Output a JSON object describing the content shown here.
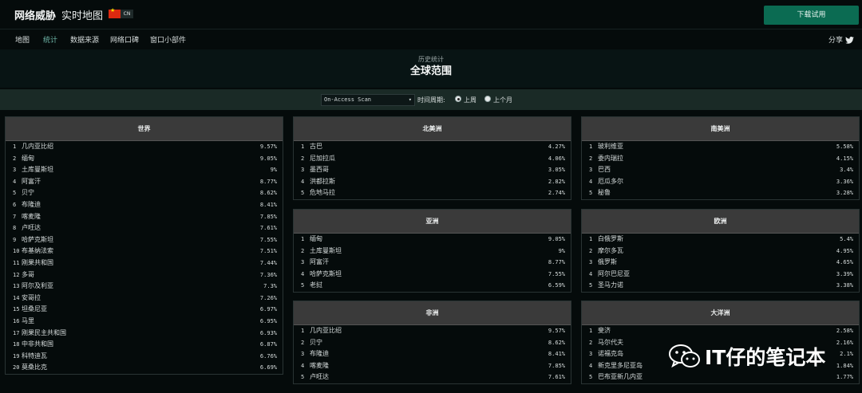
{
  "header": {
    "brand": "网络威胁",
    "subtitle": "实时地图",
    "country_code": "CN",
    "trial_button": "下载试用"
  },
  "nav": {
    "items": [
      "地图",
      "统计",
      "数据来源",
      "网络口碑",
      "窗口小部件"
    ],
    "active": "统计",
    "share": "分享"
  },
  "stats": {
    "subtitle": "历史统计",
    "title": "全球范围"
  },
  "filter": {
    "scan_type": "On-Access Scan",
    "period_label": "时间周期:",
    "options": [
      "上周",
      "上个月"
    ],
    "selected": "上周"
  },
  "panels": {
    "world": {
      "title": "世界",
      "rows": [
        {
          "rank": "1",
          "name": "几内亚比绍",
          "pct": "9.57%"
        },
        {
          "rank": "2",
          "name": "缅甸",
          "pct": "9.05%"
        },
        {
          "rank": "3",
          "name": "土库曼斯坦",
          "pct": "9%"
        },
        {
          "rank": "4",
          "name": "阿富汗",
          "pct": "8.77%"
        },
        {
          "rank": "5",
          "name": "贝宁",
          "pct": "8.62%"
        },
        {
          "rank": "6",
          "name": "布隆迪",
          "pct": "8.41%"
        },
        {
          "rank": "7",
          "name": "喀麦隆",
          "pct": "7.85%"
        },
        {
          "rank": "8",
          "name": "卢旺达",
          "pct": "7.61%"
        },
        {
          "rank": "9",
          "name": "哈萨克斯坦",
          "pct": "7.55%"
        },
        {
          "rank": "10",
          "name": "布基纳法索",
          "pct": "7.51%"
        },
        {
          "rank": "11",
          "name": "刚果共和国",
          "pct": "7.44%"
        },
        {
          "rank": "12",
          "name": "多哥",
          "pct": "7.36%"
        },
        {
          "rank": "13",
          "name": "阿尔及利亚",
          "pct": "7.3%"
        },
        {
          "rank": "14",
          "name": "安哥拉",
          "pct": "7.26%"
        },
        {
          "rank": "15",
          "name": "坦桑尼亚",
          "pct": "6.97%"
        },
        {
          "rank": "16",
          "name": "马里",
          "pct": "6.95%"
        },
        {
          "rank": "17",
          "name": "刚果民主共和国",
          "pct": "6.93%"
        },
        {
          "rank": "18",
          "name": "中非共和国",
          "pct": "6.87%"
        },
        {
          "rank": "19",
          "name": "科特迪瓦",
          "pct": "6.76%"
        },
        {
          "rank": "20",
          "name": "莫桑比克",
          "pct": "6.69%"
        }
      ]
    },
    "north_america": {
      "title": "北美洲",
      "rows": [
        {
          "rank": "1",
          "name": "古巴",
          "pct": "4.27%"
        },
        {
          "rank": "2",
          "name": "尼加拉瓜",
          "pct": "4.06%"
        },
        {
          "rank": "3",
          "name": "墨西哥",
          "pct": "3.05%"
        },
        {
          "rank": "4",
          "name": "洪都拉斯",
          "pct": "2.82%"
        },
        {
          "rank": "5",
          "name": "危地马拉",
          "pct": "2.74%"
        }
      ]
    },
    "south_america": {
      "title": "南美洲",
      "rows": [
        {
          "rank": "1",
          "name": "玻利维亚",
          "pct": "5.58%"
        },
        {
          "rank": "2",
          "name": "委内瑞拉",
          "pct": "4.15%"
        },
        {
          "rank": "3",
          "name": "巴西",
          "pct": "3.4%"
        },
        {
          "rank": "4",
          "name": "厄瓜多尔",
          "pct": "3.36%"
        },
        {
          "rank": "5",
          "name": "秘鲁",
          "pct": "3.28%"
        }
      ]
    },
    "asia": {
      "title": "亚洲",
      "rows": [
        {
          "rank": "1",
          "name": "缅甸",
          "pct": "9.05%"
        },
        {
          "rank": "2",
          "name": "土库曼斯坦",
          "pct": "9%"
        },
        {
          "rank": "3",
          "name": "阿富汗",
          "pct": "8.77%"
        },
        {
          "rank": "4",
          "name": "哈萨克斯坦",
          "pct": "7.55%"
        },
        {
          "rank": "5",
          "name": "老挝",
          "pct": "6.59%"
        }
      ]
    },
    "europe": {
      "title": "欧洲",
      "rows": [
        {
          "rank": "1",
          "name": "白俄罗斯",
          "pct": "5.4%"
        },
        {
          "rank": "2",
          "name": "摩尔多瓦",
          "pct": "4.95%"
        },
        {
          "rank": "3",
          "name": "俄罗斯",
          "pct": "4.65%"
        },
        {
          "rank": "4",
          "name": "阿尔巴尼亚",
          "pct": "3.39%"
        },
        {
          "rank": "5",
          "name": "圣马力诺",
          "pct": "3.38%"
        }
      ]
    },
    "africa": {
      "title": "非洲",
      "rows": [
        {
          "rank": "1",
          "name": "几内亚比绍",
          "pct": "9.57%"
        },
        {
          "rank": "2",
          "name": "贝宁",
          "pct": "8.62%"
        },
        {
          "rank": "3",
          "name": "布隆迪",
          "pct": "8.41%"
        },
        {
          "rank": "4",
          "name": "喀麦隆",
          "pct": "7.85%"
        },
        {
          "rank": "5",
          "name": "卢旺达",
          "pct": "7.61%"
        }
      ]
    },
    "oceania": {
      "title": "大洋洲",
      "rows": [
        {
          "rank": "1",
          "name": "斐济",
          "pct": "2.58%"
        },
        {
          "rank": "2",
          "name": "马尔代夫",
          "pct": "2.16%"
        },
        {
          "rank": "3",
          "name": "诺福克岛",
          "pct": "2.1%"
        },
        {
          "rank": "4",
          "name": "新克里多尼亚岛",
          "pct": "1.84%"
        },
        {
          "rank": "5",
          "name": "巴布亚新几内亚",
          "pct": "1.77%"
        }
      ]
    }
  },
  "watermark": {
    "text": "IT仔的笔记本",
    "icon": "wechat-icon"
  },
  "colors": {
    "accent": "#0b6b52",
    "background": "#050b0b",
    "panel_header": "#3a3a3a"
  }
}
